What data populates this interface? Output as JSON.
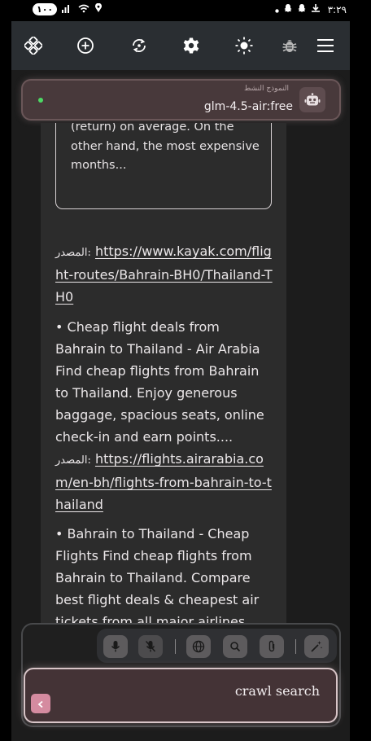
{
  "status_bar": {
    "battery": "١٠٠",
    "time": "٣:٢٩"
  },
  "toolbar": {
    "icons": [
      "move-icon",
      "add-icon",
      "refresh-icon",
      "settings-icon",
      "theme-icon",
      "bug-icon",
      "menu-icon"
    ]
  },
  "model": {
    "caption": "النموذج النشط",
    "name": "glm-4.5-air:free",
    "status_color": "#4cd964"
  },
  "message": {
    "quote_text": "(return) on average. On the other hand, the most expensive months...",
    "items": [
      {
        "source_label": "المصدر:",
        "source_url": "https://www.kayak.com/flight-routes/Bahrain-BH0/Thailand-TH0"
      },
      {
        "text": "• Cheap flight deals from Bahrain to Thailand - Air Arabia Find cheap flights from Bahrain to Thailand. Enjoy generous baggage, spacious seats, online check-in and earn points....",
        "source_label": "المصدر:",
        "source_url": "https://flights.airarabia.com/en-bh/flights-from-bahrain-to-thailand"
      },
      {
        "text": "• Bahrain to Thailand - Cheap Flights Find cheap flights from Bahrain to Thailand. Compare best flight deals & cheapest air tickets from all major airlines."
      }
    ]
  },
  "composer": {
    "tools": [
      "mic-icon",
      "mic-off-icon",
      "globe-icon",
      "search-icon",
      "attach-icon",
      "magic-wand-icon"
    ],
    "input_value": "crawl search"
  },
  "colors": {
    "accent": "#d58ba0",
    "app_background": "#1c1c1c",
    "card_background": "#2c2c2c"
  }
}
